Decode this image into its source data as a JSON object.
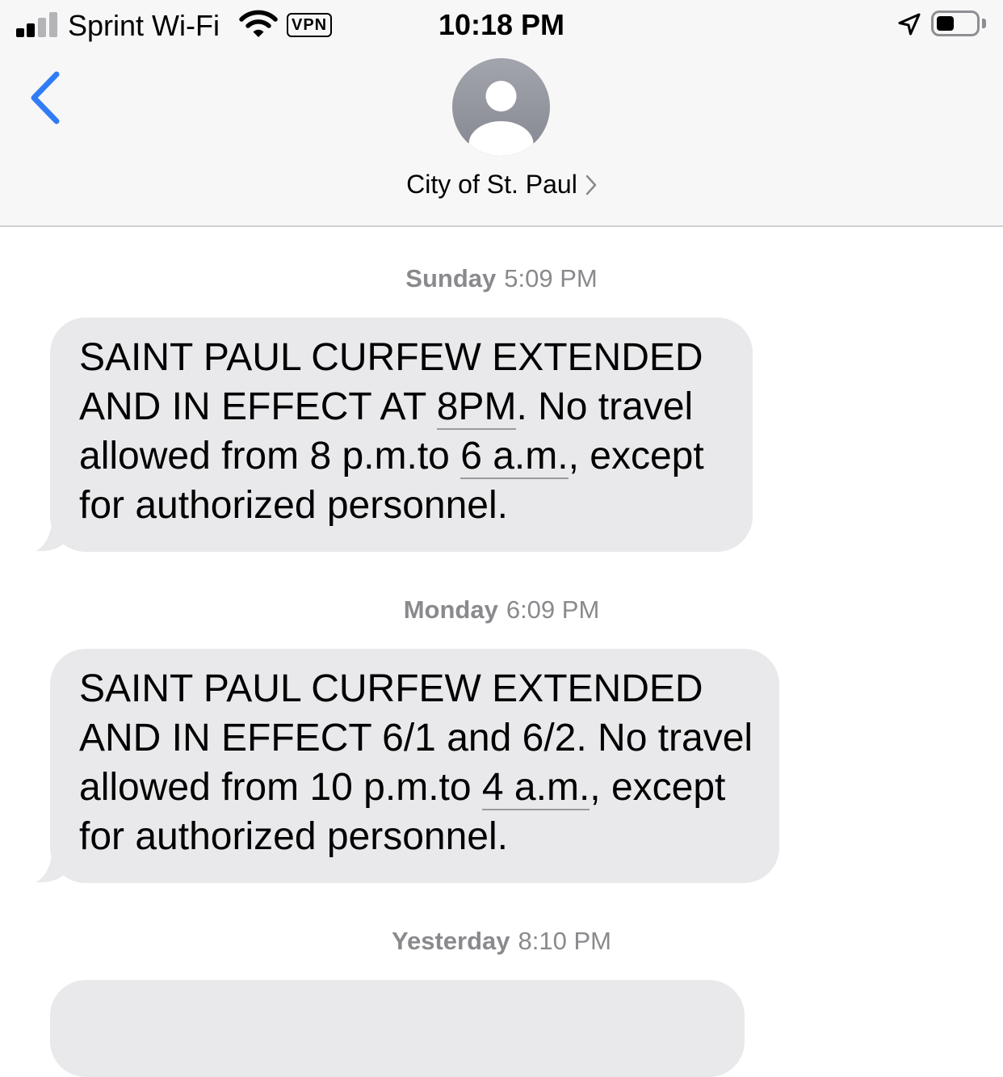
{
  "status_bar": {
    "carrier": "Sprint Wi-Fi",
    "vpn_label": "VPN",
    "time": "10:18 PM",
    "battery_level": 0.45
  },
  "header": {
    "contact_name": "City of St. Paul"
  },
  "messages": [
    {
      "day": "Sunday",
      "time": "5:09 PM",
      "parts": [
        "SAINT PAUL CURFEW EXTENDED AND IN EFFECT AT ",
        "8PM",
        ". No travel allowed from 8 p.m.to ",
        "6 a.m.",
        ", except for authorized personnel."
      ]
    },
    {
      "day": "Monday",
      "time": "6:09 PM",
      "parts": [
        "SAINT PAUL CURFEW EXTENDED AND IN EFFECT 6/1 and 6/2. No travel allowed from 10 p.m.to ",
        "4 a.m.",
        ", except for authorized personnel."
      ]
    },
    {
      "day": "Yesterday",
      "time": "8:10 PM"
    }
  ],
  "colors": {
    "header_bg": "#f7f7f7",
    "bubble_bg": "#e9e9eb",
    "accent": "#2f7cf6",
    "timestamp": "#8a8a8e"
  },
  "icons": {
    "back": "chevron-left-icon",
    "avatar": "person-silhouette-icon",
    "location": "location-arrow-icon"
  }
}
